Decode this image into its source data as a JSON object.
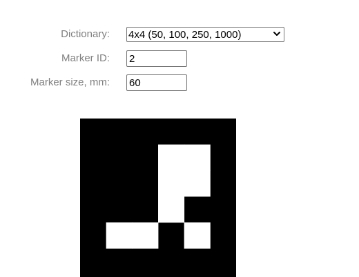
{
  "form": {
    "dictionary": {
      "label": "Dictionary:",
      "selected": "4x4 (50, 100, 250, 1000)",
      "options": [
        "4x4 (50, 100, 250, 1000)"
      ]
    },
    "marker_id": {
      "label": "Marker ID:",
      "value": "2"
    },
    "marker_size": {
      "label": "Marker size, mm:",
      "value": "60"
    }
  },
  "marker": {
    "grid_bits": [
      [
        0,
        0,
        0,
        0,
        0,
        0
      ],
      [
        0,
        0,
        0,
        1,
        1,
        0
      ],
      [
        0,
        0,
        0,
        1,
        1,
        0
      ],
      [
        0,
        0,
        0,
        1,
        0,
        0
      ],
      [
        0,
        1,
        1,
        0,
        1,
        0
      ],
      [
        0,
        0,
        0,
        0,
        0,
        0
      ]
    ],
    "colors": {
      "black": "#000000",
      "white": "#ffffff"
    }
  }
}
